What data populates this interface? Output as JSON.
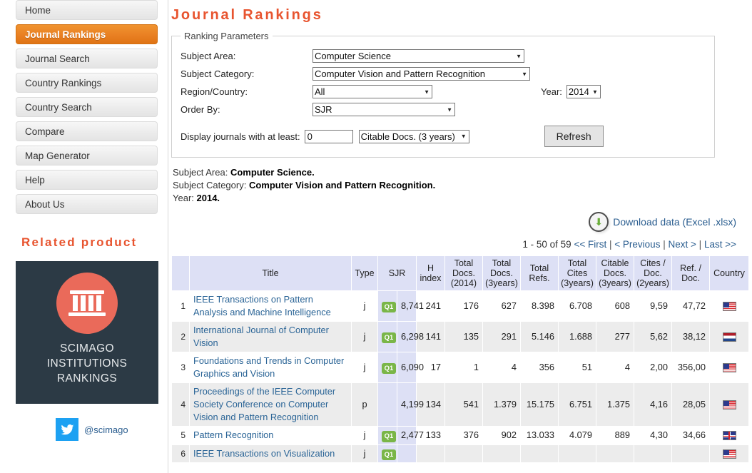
{
  "sidebar": {
    "nav_items": [
      {
        "label": "Home",
        "active": false
      },
      {
        "label": "Journal Rankings",
        "active": true
      },
      {
        "label": "Journal Search",
        "active": false
      },
      {
        "label": "Country Rankings",
        "active": false
      },
      {
        "label": "Country Search",
        "active": false
      },
      {
        "label": "Compare",
        "active": false
      },
      {
        "label": "Map Generator",
        "active": false
      },
      {
        "label": "Help",
        "active": false
      },
      {
        "label": "About Us",
        "active": false
      }
    ],
    "related_title": "Related product",
    "product": {
      "line1": "SCIMAGO",
      "line2": "INSTITUTIONS",
      "line3": "RANKINGS",
      "icon": "classical-temple-icon",
      "bg_color": "#2c3a45",
      "circle_color": "#ea6a5a"
    },
    "twitter": {
      "icon": "twitter-bird-icon",
      "handle": "@scimago",
      "color": "#1da1f2"
    }
  },
  "main": {
    "page_title": "Journal Rankings",
    "title_color": "#e8542f",
    "params": {
      "legend": "Ranking Parameters",
      "subject_area_label": "Subject Area:",
      "subject_area_value": "Computer Science",
      "subject_category_label": "Subject Category:",
      "subject_category_value": "Computer Vision and Pattern Recognition",
      "region_label": "Region/Country:",
      "region_value": "All",
      "year_label": "Year:",
      "year_value": "2014",
      "order_by_label": "Order By:",
      "order_by_value": "SJR",
      "display_label": "Display journals with at least:",
      "display_value": "0",
      "metric_value": "Citable Docs. (3 years)",
      "refresh_label": "Refresh"
    },
    "summary": {
      "subject_area_label": "Subject Area:",
      "subject_area_value": "Computer Science.",
      "subject_category_label": "Subject Category:",
      "subject_category_value": "Computer Vision and Pattern Recognition.",
      "year_label": "Year:",
      "year_value": "2014."
    },
    "download": {
      "icon": "download-arrow-icon",
      "label": "Download data (Excel .xlsx)"
    },
    "pager": {
      "count": "1 - 50 of 59",
      "first": "<< First",
      "previous": "< Previous",
      "next": "Next >",
      "last": "Last >>",
      "sep": "|"
    },
    "table": {
      "header_bg": "#dde0f5",
      "sjr_col_bg": "#dde0f5",
      "q_badge_color": "#7ab648",
      "columns": [
        {
          "key": "idx",
          "label": ""
        },
        {
          "key": "title",
          "label": "Title"
        },
        {
          "key": "type",
          "label": "Type"
        },
        {
          "key": "sjr",
          "label": "SJR"
        },
        {
          "key": "h",
          "label": "H index"
        },
        {
          "key": "td2014",
          "label": "Total Docs. (2014)"
        },
        {
          "key": "td3y",
          "label": "Total Docs. (3years)"
        },
        {
          "key": "trefs",
          "label": "Total Refs."
        },
        {
          "key": "tcites",
          "label": "Total Cites (3years)"
        },
        {
          "key": "cdocs",
          "label": "Citable Docs. (3years)"
        },
        {
          "key": "cpd",
          "label": "Cites / Doc. (2years)"
        },
        {
          "key": "rpd",
          "label": "Ref. / Doc."
        },
        {
          "key": "country",
          "label": "Country"
        }
      ],
      "rows": [
        {
          "idx": "1",
          "title": "IEEE Transactions on Pattern Analysis and Machine Intelligence",
          "type": "j",
          "quartile": "Q1",
          "sjr": "8,741",
          "h": "241",
          "td2014": "176",
          "td3y": "627",
          "trefs": "8.398",
          "tcites": "6.708",
          "cdocs": "608",
          "cpd": "9,59",
          "rpd": "47,72",
          "country": "United States",
          "flag": "fl-us"
        },
        {
          "idx": "2",
          "title": "International Journal of Computer Vision",
          "type": "j",
          "quartile": "Q1",
          "sjr": "6,298",
          "h": "141",
          "td2014": "135",
          "td3y": "291",
          "trefs": "5.146",
          "tcites": "1.688",
          "cdocs": "277",
          "cpd": "5,62",
          "rpd": "38,12",
          "country": "Netherlands",
          "flag": "fl-nl"
        },
        {
          "idx": "3",
          "title": "Foundations and Trends in Computer Graphics and Vision",
          "type": "j",
          "quartile": "Q1",
          "sjr": "6,090",
          "h": "17",
          "td2014": "1",
          "td3y": "4",
          "trefs": "356",
          "tcites": "51",
          "cdocs": "4",
          "cpd": "2,00",
          "rpd": "356,00",
          "country": "United States",
          "flag": "fl-us"
        },
        {
          "idx": "4",
          "title": "Proceedings of the IEEE Computer Society Conference on Computer Vision and Pattern Recognition",
          "type": "p",
          "quartile": "",
          "sjr": "4,199",
          "h": "134",
          "td2014": "541",
          "td3y": "1.379",
          "trefs": "15.175",
          "tcites": "6.751",
          "cdocs": "1.375",
          "cpd": "4,16",
          "rpd": "28,05",
          "country": "United States",
          "flag": "fl-us"
        },
        {
          "idx": "5",
          "title": "Pattern Recognition",
          "type": "j",
          "quartile": "Q1",
          "sjr": "2,477",
          "h": "133",
          "td2014": "376",
          "td3y": "902",
          "trefs": "13.033",
          "tcites": "4.079",
          "cdocs": "889",
          "cpd": "4,30",
          "rpd": "34,66",
          "country": "United Kingdom",
          "flag": "fl-uk"
        },
        {
          "idx": "6",
          "title": "IEEE Transactions on Visualization",
          "type": "j",
          "quartile": "Q1",
          "sjr": "",
          "h": "",
          "td2014": "",
          "td3y": "",
          "trefs": "",
          "tcites": "",
          "cdocs": "",
          "cpd": "",
          "rpd": "",
          "country": "United States",
          "flag": "fl-us"
        }
      ]
    }
  }
}
